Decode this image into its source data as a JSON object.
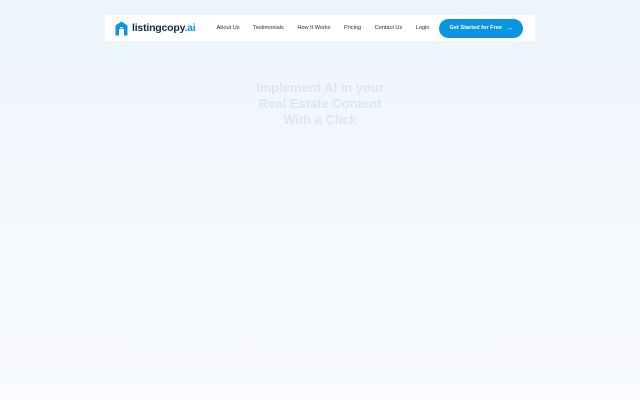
{
  "brand": {
    "name_main": "listingcopy",
    "name_suffix": ".ai",
    "logo_icon": "house-logo-icon",
    "accent_color": "#0b94e0"
  },
  "nav": {
    "links": [
      "About Us",
      "Testimonials",
      "How It Works",
      "Pricing",
      "Contact Us"
    ],
    "login": "Login",
    "cta": {
      "label": "Get Started for Free",
      "icon": "arrow-right-icon",
      "glyph": "→"
    }
  },
  "hero": {
    "lines": [
      "Implement AI in your",
      "Real Estate Content",
      "With a Click"
    ]
  }
}
